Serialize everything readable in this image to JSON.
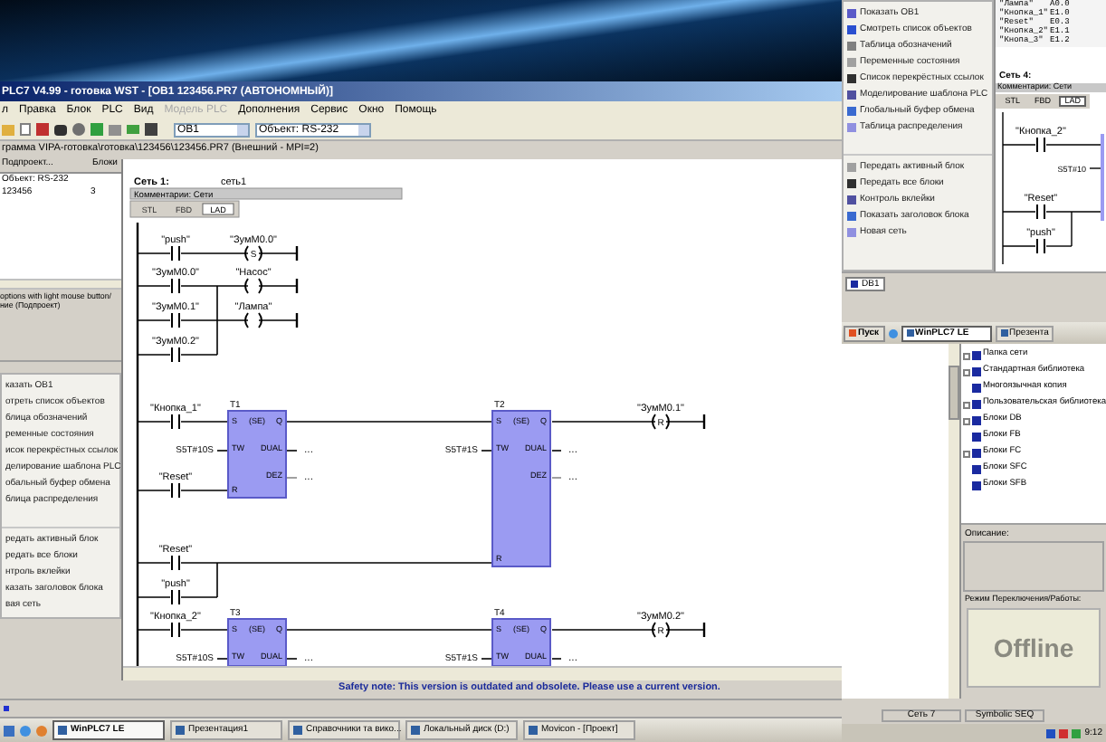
{
  "main_window": {
    "title": "PLC7 V4.99 - готовка WST - [OB1 123456.PR7 (АВТОНОМНЫЙ)]",
    "menu": [
      {
        "label": "л",
        "disabled": false
      },
      {
        "label": "Правка",
        "disabled": false
      },
      {
        "label": "Блок",
        "disabled": false
      },
      {
        "label": "PLC",
        "disabled": false
      },
      {
        "label": "Вид",
        "disabled": false
      },
      {
        "label": "Модель PLC",
        "disabled": true
      },
      {
        "label": "Дополнения",
        "disabled": false
      },
      {
        "label": "Сервис",
        "disabled": false
      },
      {
        "label": "Окно",
        "disabled": false
      },
      {
        "label": "Помощь",
        "disabled": false
      }
    ],
    "toolbar": {
      "block_combo": "OB1",
      "object_combo": "Объект: RS-232"
    },
    "path": "грамма VIPA-готовка\\готовка\\123456\\123456.PR7  (Внешний - MPI=2)",
    "project_panel": {
      "columns": [
        "Подпроект...",
        "Блоки"
      ],
      "rows": [
        {
          "name": "Объект: RS-232"
        },
        {
          "name": "123456",
          "blocks": "3"
        }
      ],
      "hint_lines": [
        "options with light mouse button/",
        "ние (Подпроект)"
      ]
    },
    "command_menu": [
      [
        "казать OB1",
        "отреть список объектов",
        "блица обозначений",
        "ременные состояния",
        "исок перекрёстных ссылок",
        "делирование шаблона PLC",
        "обальный буфер обмена",
        "блица распределения"
      ],
      [
        "редать активный блок",
        "редать все блоки",
        "нтроль вклейки",
        "казать заголовок блока",
        "вая сеть"
      ]
    ],
    "editor": {
      "network": {
        "title": "Сеть 1:",
        "name": "сеть1",
        "comment": "Комментарии: Сети",
        "views": [
          {
            "label": "STL",
            "selected": false
          },
          {
            "label": "FBD",
            "selected": false
          },
          {
            "label": "LAD",
            "selected": true
          }
        ]
      },
      "rung_contacts": [
        "\"push\"",
        "\"ЗумМ0.0\"",
        "\"ЗумМ0.1\"",
        "\"ЗумМ0.2\""
      ],
      "rung_coils": [
        {
          "label": "\"ЗумМ0.0\"",
          "op": "S"
        },
        {
          "label": "\"Насос\""
        },
        {
          "label": "\"Лампа\""
        }
      ],
      "timer_network": {
        "start_contact": "\"Кнопка_1\"",
        "t1_reset_contact": "\"Reset\"",
        "reset_contacts": [
          "\"Reset\"",
          "\"push\""
        ],
        "coil": {
          "label": "\"ЗумМ0.1\"",
          "op": "R"
        },
        "timers": [
          {
            "name": "T1",
            "type": "(SE)",
            "s": "S",
            "q": "Q",
            "tw": "TW",
            "tw_value": "S5T#10S",
            "dual": "DUAL",
            "dez": "DEZ",
            "r": "R",
            "dual_out": "...",
            "dez_out": "..."
          },
          {
            "name": "T2",
            "type": "(SE)",
            "s": "S",
            "q": "Q",
            "tw": "TW",
            "tw_value": "S5T#1S",
            "dual": "DUAL",
            "dez": "DEZ",
            "r": "R",
            "dual_out": "...",
            "dez_out": "..."
          }
        ]
      },
      "timer_network_2": {
        "start_contact": "\"Кнопка_2\"",
        "coil": {
          "label": "\"ЗумМ0.2\"",
          "op": "R"
        },
        "timers": [
          {
            "name": "T3",
            "type": "(SE)",
            "s": "S",
            "q": "Q",
            "tw": "TW",
            "tw_value": "S5T#10S",
            "dual": "DUAL",
            "dual_out": "..."
          },
          {
            "name": "T4",
            "type": "(SE)",
            "s": "S",
            "q": "Q",
            "tw": "TW",
            "tw_value": "S5T#1S",
            "dual": "DUAL",
            "dual_out": "..."
          }
        ]
      }
    },
    "safety_note": "Safety note: This version is outdated and obsolete. Please use a current version.",
    "taskbar": [
      {
        "label": "WinPLC7 LE",
        "active": true
      },
      {
        "label": "Презентация1",
        "active": false
      },
      {
        "label": "Справочники та вико...",
        "active": false
      },
      {
        "label": "Локальный диск (D:)",
        "active": false
      },
      {
        "label": "Movicon - [Проект]",
        "active": false
      }
    ]
  },
  "overlay_window": {
    "command_menu": [
      [
        "Показать OB1",
        "Смотреть список объектов",
        "Таблица обозначений",
        "Переменные состояния",
        "Список перекрёстных ссылок",
        "Моделирование шаблона PLC",
        "Глобальный буфер обмена",
        "Таблица распределения"
      ],
      [
        "Передать активный блок",
        "Передать все блоки",
        "Контроль вклейки",
        "Показать заголовок блока",
        "Новая сеть"
      ]
    ],
    "symbol_table": [
      {
        "symbol": "\"Лампа\"",
        "address": "A0.0"
      },
      {
        "symbol": "\"Кнопка_1\"",
        "address": "E1.0"
      },
      {
        "symbol": "\"Reset\"",
        "address": "E0.3"
      },
      {
        "symbol": "\"Кнопка_2\"",
        "address": "E1.1"
      },
      {
        "symbol": "\"Кнопа_3\"",
        "address": "E1.2"
      }
    ],
    "network": {
      "title": "Сеть 4:",
      "comment": "Комментарии: Сети",
      "views": [
        {
          "label": "STL",
          "selected": false
        },
        {
          "label": "FBD",
          "selected": false
        },
        {
          "label": "LAD",
          "selected": true
        }
      ]
    },
    "ladder": {
      "start_contact": "\"Кнопка_2\"",
      "tw_value": "S5T#10",
      "reset_contacts": [
        "\"Reset\"",
        "\"push\""
      ]
    },
    "editor_tab": "DB1",
    "taskbar": {
      "start": "Пуск",
      "items": [
        {
          "label": "WinPLC7 LE",
          "active": true
        },
        {
          "label": "Презента",
          "active": false
        }
      ]
    },
    "library_tree": [
      {
        "label": "Папка сети",
        "collapsed": true
      },
      {
        "label": "Стандартная библиотека",
        "collapsed": true
      },
      {
        "label": "Многоязычная копия",
        "collapsed": false
      },
      {
        "label": "Пользовательская библиотека",
        "collapsed": true
      },
      {
        "label": "Блоки DB",
        "collapsed": true
      },
      {
        "label": "Блоки FB",
        "collapsed": false
      },
      {
        "label": "Блоки FC",
        "collapsed": true
      },
      {
        "label": "Блоки SFC",
        "collapsed": false
      },
      {
        "label": "Блоки SFB",
        "collapsed": false
      }
    ],
    "description_label": "Описание:",
    "mode_label": "Режим Переключения/Работы:",
    "mode": "Offline",
    "status_cells": [
      "Сеть 7",
      "Symbolic SEQ"
    ],
    "clock": "9:12"
  }
}
